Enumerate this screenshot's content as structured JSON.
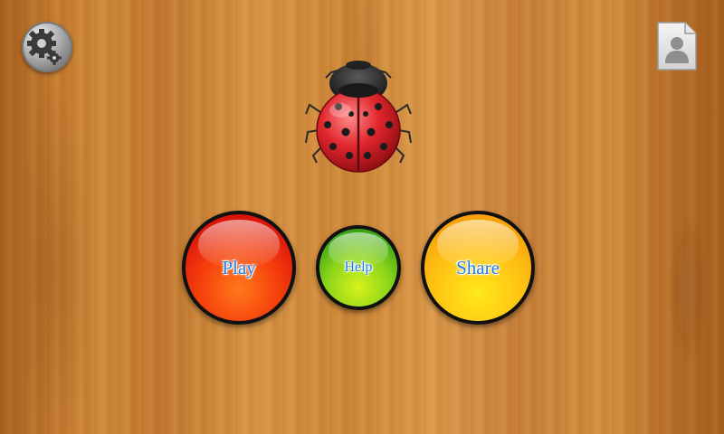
{
  "buttons": {
    "play": "Play",
    "help": "Help",
    "share": "Share"
  },
  "icons": {
    "settings": "gears-icon",
    "profile": "profile-card-icon",
    "mascot": "ladybug-icon"
  },
  "colors": {
    "play": "#f43d0c",
    "help": "#5cbf17",
    "share": "#ffc414",
    "label": "#1e7ee8"
  }
}
